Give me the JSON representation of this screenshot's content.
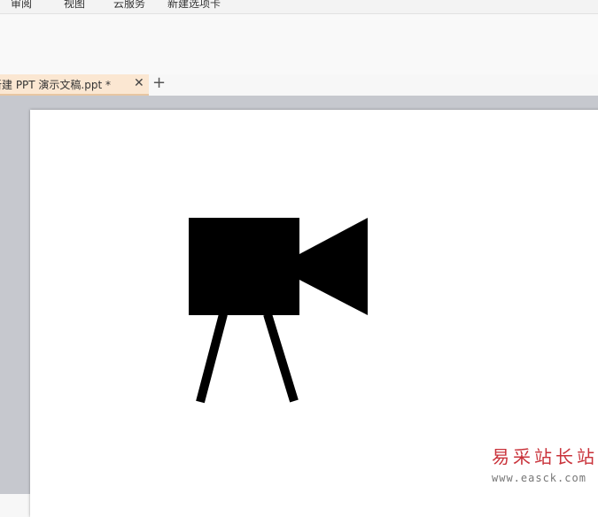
{
  "menu": {
    "items": [
      {
        "label": "审阅"
      },
      {
        "label": "视图"
      },
      {
        "label": "云服务"
      },
      {
        "label": "新建选项卡"
      }
    ]
  },
  "tabs": {
    "document_title": "新建 PPT 演示文稿.ppt *",
    "close_icon": "close-icon",
    "add_icon": "plus-icon",
    "active_color": "#fbe7d2"
  },
  "slide": {
    "shape": "video-camera-on-tripod",
    "shape_color": "#000000"
  },
  "watermark": {
    "title": "易采站长站",
    "url": "www.easck.com",
    "title_color": "#c9323a"
  }
}
